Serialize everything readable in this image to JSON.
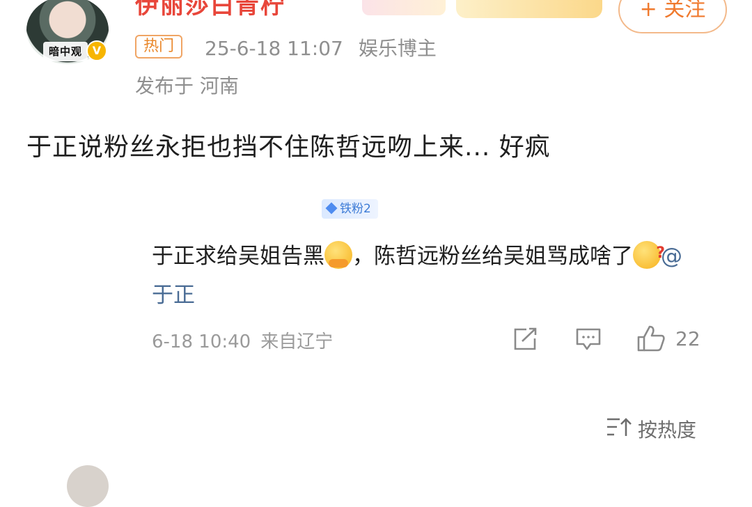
{
  "author": {
    "name": "伊丽莎白青柠",
    "avatar_tag": "暗中观",
    "verify_mark": "V",
    "follow_label": "+ 关注"
  },
  "post": {
    "hot_badge": "热门",
    "timestamp": "25-6-18 11:07",
    "category": "娱乐博主",
    "location": "发布于 河南",
    "text": "于正说粉丝永拒也挡不住陈哲远吻上来... 好疯"
  },
  "comment": {
    "fan_badge": "铁粉2",
    "text_part1": "于正求给吴姐告黑",
    "text_part2": "，陈哲远粉丝给吴姐骂成啥了",
    "mention": "@于正",
    "time": "6-18 10:40",
    "source": "来自辽宁",
    "like_count": "22"
  },
  "sort": {
    "label": "按热度"
  },
  "icons": {
    "share": "share-icon",
    "reply": "comment-icon",
    "like": "thumbs-up-icon",
    "sort": "sort-icon"
  },
  "colors": {
    "username": "#e8463a",
    "follow": "#f07a2e",
    "hot": "#e9872a",
    "mention": "#4a6c95",
    "fan_badge": "#3d7bd6"
  }
}
